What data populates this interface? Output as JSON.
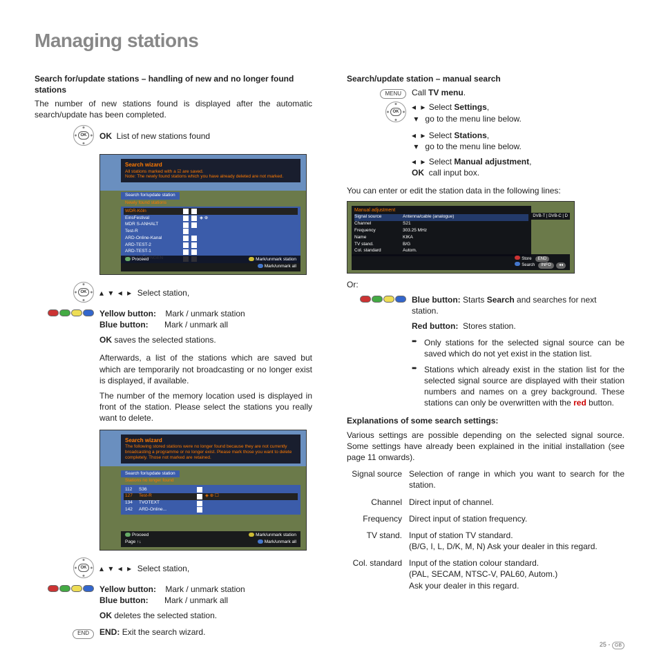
{
  "title": "Managing stations",
  "left": {
    "sec1_head": "Search for/update stations – handling of new and no longer found stations",
    "sec1_p1": "The number of new stations found is displayed after the automatic search/update has been completed.",
    "ok_list": "List of new stations found",
    "ok_bold": "OK",
    "select_station": "Select station,",
    "yellow_label": "Yellow button:",
    "yellow_desc": "Mark / unmark station",
    "blue_label": "Blue button:",
    "blue_desc": "Mark / unmark all",
    "ok_saves_b": "OK",
    "ok_saves": "saves the selected stations.",
    "after_p1": "Afterwards, a list of the stations which are saved but which are temporarily not broadcasting or no longer exist is displayed, if available.",
    "after_p2": "The number of the memory location used is displayed in front of the station. Please select the stations you really want to delete.",
    "select_station2": "Select station,",
    "yellow_label2": "Yellow button:",
    "yellow_desc2": "Mark / unmark station",
    "blue_label2": "Blue button:",
    "blue_desc2": "Mark / unmark all",
    "ok_del_b": "OK",
    "ok_del": "deletes the selected station.",
    "end_b": "END:",
    "end_txt": "Exit the search wizard.",
    "shot1": {
      "title": "Search wizard",
      "warn1": "All stations marked with a ☑ are saved.",
      "warn2": "Note: The newly found stations which you have already deleted are not marked.",
      "tab": "Search for/update station",
      "subtab": "Newly found stations",
      "rows": [
        {
          "name": "WDR-Köln"
        },
        {
          "name": "EinsFestival"
        },
        {
          "name": "MDR S-ANHALT"
        },
        {
          "name": "Test-R"
        },
        {
          "name": "ARD-Online-Kanal"
        },
        {
          "name": "ARD-TEST-2"
        },
        {
          "name": "ARD-TEST-1"
        },
        {
          "name": "MDR THÜRINGEN"
        }
      ],
      "f1": "Proceed",
      "f2": "Mark/unmark station",
      "f3": "Mark/unmark all"
    },
    "shot2": {
      "title": "Search wizard",
      "warn": "The following stored stations were no longer found because they are not currently broadcasting a programme or no longer exist. Please mark those you want to delete completely. Those not marked are retained.",
      "tab": "Search for/update station",
      "subtab": "Stations no longer found",
      "rows": [
        {
          "num": "112",
          "name": "S36"
        },
        {
          "num": "127",
          "name": "Test-R"
        },
        {
          "num": "134",
          "name": "TVOTEXT"
        },
        {
          "num": "142",
          "name": "ARD-Online..."
        }
      ],
      "f1": "Proceed",
      "f1b": "Page ↑↓",
      "f2": "Mark/unmark station",
      "f3": "Mark/unmark all"
    }
  },
  "right": {
    "sec2_head": "Search/update station – manual search",
    "menu_btn": "MENU",
    "call_tv": "Call ",
    "call_tv_b": "TV menu",
    "s1a": "Select ",
    "s1b": "Settings",
    "s1c": "go to the menu line below.",
    "s2a": "Select ",
    "s2b": "Stations",
    "s2c": "go to the menu line below.",
    "s3a": "Select ",
    "s3b": "Manual adjustment",
    "s3ok": "OK",
    "s3c": "call input box.",
    "intro_txt": "You can enter or edit the station data in the following lines:",
    "shot3": {
      "title": "Manual adjustment",
      "tabs": "DVB-T  |  DVB-C  |  D",
      "rows": [
        {
          "lbl": "Signal source",
          "val": "Antenna/cable (analogue)"
        },
        {
          "lbl": "Channel",
          "val": "S21"
        },
        {
          "lbl": "Frequency",
          "val": "303.25 MHz"
        },
        {
          "lbl": "Name",
          "val": "KIKA"
        },
        {
          "lbl": "TV stand.",
          "val": "B/G"
        },
        {
          "lbl": "Col. standard",
          "val": "Autom."
        }
      ],
      "store": "Store",
      "search": "Search"
    },
    "or": "Or:",
    "blue_b": "Blue button:",
    "blue_txt1": "Starts ",
    "blue_txt2": "Search",
    "blue_txt3": " and searches for next station.",
    "red_b": "Red button:",
    "red_txt": "Stores station.",
    "b1": "Only stations for the selected signal source can be saved which do not yet exist in the station list.",
    "b2a": "Stations which already exist in the station list for the selected signal source are displayed with their station numbers and names on a grey background. These stations can only be overwritten with the ",
    "b2b": "red",
    "b2c": " button.",
    "exp_head": "Explanations of some search settings:",
    "exp_intro": "Various settings are possible depending on the selected signal source. Some settings have already been explained in the initial installation (see page 11 onwards).",
    "exp": [
      {
        "lbl": "Signal source",
        "desc": "Selection of range in which you want to search for the station."
      },
      {
        "lbl": "Channel",
        "desc": "Direct input of channel."
      },
      {
        "lbl": "Frequency",
        "desc": "Direct input of station frequency."
      },
      {
        "lbl": "TV stand.",
        "desc": "Input of station TV standard.\n(B/G, I, L, D/K, M, N) Ask your dealer in this regard."
      },
      {
        "lbl": "Col. standard",
        "desc": "Input of the station colour standard.\n(PAL, SECAM, NTSC-V, PAL60, Autom.)\nAsk your dealer in this regard."
      }
    ]
  },
  "page": "25 -",
  "region": "GB"
}
